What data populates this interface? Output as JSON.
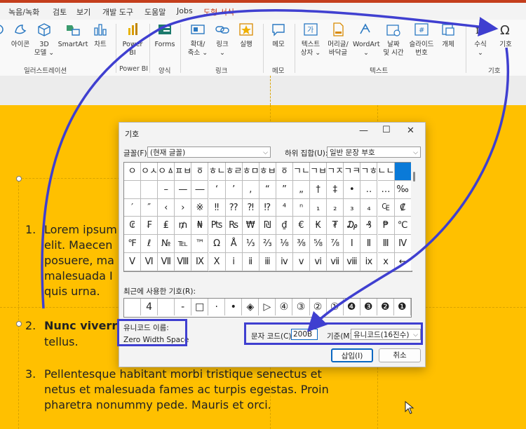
{
  "tabs": [
    "녹음/녹화",
    "검토",
    "보기",
    "개발 도구",
    "도움말",
    "Jobs",
    "도형 서식"
  ],
  "ribbon": {
    "buttons": [
      {
        "label": "아이콘",
        "icon": "icons-icon"
      },
      {
        "label": "3D\n모델 ⌄",
        "icon": "3d-model-icon"
      },
      {
        "label": "SmartArt",
        "icon": "smartart-icon"
      },
      {
        "label": "차트",
        "icon": "chart-icon"
      },
      {
        "label": "Power\nBI",
        "icon": "powerbi-icon"
      },
      {
        "label": "Forms",
        "icon": "forms-icon"
      },
      {
        "label": "확대/\n축소 ⌄",
        "icon": "zoom-icon"
      },
      {
        "label": "링크\n⌄",
        "icon": "link-icon"
      },
      {
        "label": "실행",
        "icon": "action-icon"
      },
      {
        "label": "메모",
        "icon": "comment-icon"
      },
      {
        "label": "텍스트\n상자 ⌄",
        "icon": "textbox-icon"
      },
      {
        "label": "머리글/\n바닥글",
        "icon": "header-footer-icon"
      },
      {
        "label": "WordArt\n⌄",
        "icon": "wordart-icon"
      },
      {
        "label": "날짜\n및 시간",
        "icon": "datetime-icon"
      },
      {
        "label": "슬라이드\n번호",
        "icon": "slide-number-icon"
      },
      {
        "label": "개체",
        "icon": "object-icon"
      },
      {
        "label": "수식\n⌄",
        "icon": "equation-icon"
      },
      {
        "label": "기호",
        "icon": "omega-icon"
      }
    ],
    "groups": [
      "일러스트레이션",
      "Power BI",
      "양식",
      "링크",
      "메모",
      "텍스트",
      "기호"
    ]
  },
  "slide": {
    "items": [
      {
        "num": "1.",
        "lines": [
          "Lorem ipsum",
          "elit. Maecen",
          "posuere, ma",
          "malesuada I",
          "quis urna."
        ]
      },
      {
        "num": "2.",
        "lines": [
          "Nunc viverr",
          "tellus."
        ]
      },
      {
        "num": "3.",
        "lines": [
          "Pellentesque habitant morbi tristique senectus et",
          "netus et malesuada fames ac turpis egestas. Proin",
          "pharetra nonummy pede. Mauris et orci."
        ]
      }
    ]
  },
  "dialog": {
    "title": "기호",
    "font_label": "글꼴(F):",
    "font_value": "(현재 글꼴)",
    "subset_label": "하위 집합(U):",
    "subset_value": "일반 문장 부호",
    "symbols": [
      [
        "ㅇ",
        "ㅇㅅ",
        "ㅇㅿ",
        "ㅍㅂ",
        "ㆆ",
        "ㅎㄴ",
        "ㅎㄹ",
        "ㅎㅁ",
        "ㅎㅂ",
        "ㆆ",
        "ㄱㄴ",
        "ㄱㅂ",
        "ㄱㅈ",
        "ㄱㅋ",
        "ㄱㅎ",
        "ㄴㄴ",
        "ㄴ"
      ],
      [
        "",
        "",
        "–",
        "—",
        "―",
        "‘",
        "’",
        "‚",
        "“",
        "”",
        "„",
        "†",
        "‡",
        "•",
        "‥",
        "…",
        "‰"
      ],
      [
        "′",
        "″",
        "‹",
        "›",
        "※",
        "‼",
        "⁇",
        "⁈",
        "⁉",
        "⁴",
        "ⁿ",
        "₁",
        "₂",
        "₃",
        "₄",
        "₠",
        "₡"
      ],
      [
        "₢",
        "₣",
        "₤",
        "₥",
        "₦",
        "₧",
        "₨",
        "₩",
        "₪",
        "₫",
        "€",
        "₭",
        "₮",
        "₯",
        "₰",
        "₱",
        "℃"
      ],
      [
        "℉",
        "ℓ",
        "№",
        "℡",
        "™",
        "Ω",
        "Å",
        "⅓",
        "⅔",
        "⅛",
        "⅜",
        "⅝",
        "⅞",
        "Ⅰ",
        "Ⅱ",
        "Ⅲ",
        "Ⅳ"
      ],
      [
        "Ⅴ",
        "Ⅵ",
        "Ⅶ",
        "Ⅷ",
        "Ⅸ",
        "Ⅹ",
        "ⅰ",
        "ⅱ",
        "ⅲ",
        "ⅳ",
        "ⅴ",
        "ⅵ",
        "ⅶ",
        "ⅷ",
        "ⅸ",
        "ⅹ",
        "←"
      ]
    ],
    "recent_label": "최근에 사용한 기호(R):",
    "recent": [
      "",
      "4",
      "",
      "-",
      "□",
      "·",
      "•",
      "◈",
      "▷",
      "④",
      "③",
      "②",
      "①",
      "❹",
      "❸",
      "❷",
      "❶"
    ],
    "unicode_name_label": "유니코드 이름:",
    "unicode_name_value": "Zero Width Space",
    "char_code_label": "문자 코드(C):",
    "char_code_value": "200B",
    "from_label": "기준(M):",
    "from_value": "유니코드(16진수)",
    "insert_label": "삽입(I)",
    "cancel_label": "취소"
  },
  "colors": {
    "slide": "#ffc000",
    "accent": "#c43e1c",
    "annotation": "#3f3fd0",
    "selection": "#0a7ad8"
  }
}
